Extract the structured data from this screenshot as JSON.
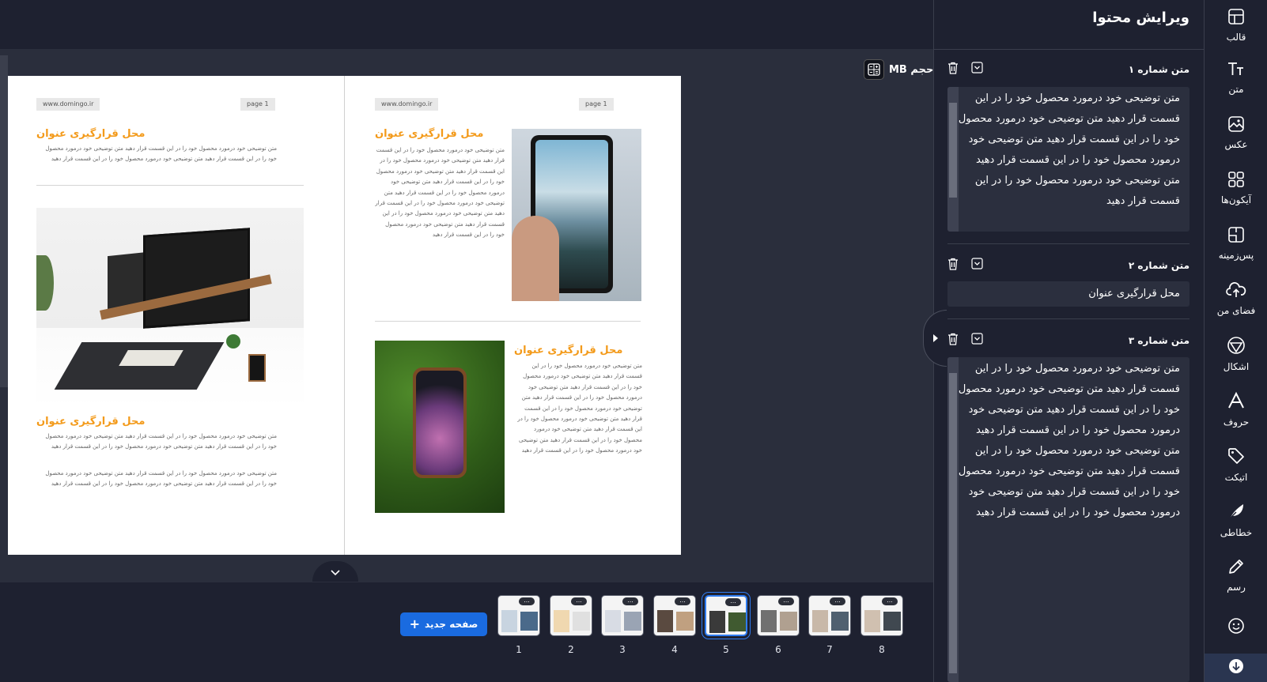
{
  "canvas": {
    "size_label": "حجم MB",
    "pages": [
      {
        "site_url": "www.domingo.ir",
        "page_label": "page 1",
        "heading1": "محل قرارگیری عنوان",
        "text1": "متن توضیحی خود درمورد محصول خود را در این قسمت قرار دهید متن توضیحی خود درمورد محصول خود را در این قسمت قرار دهید متن توضیحی خود درمورد محصول خود را در این قسمت قرار دهید",
        "heading2": "محل قرارگیری عنوان",
        "text2": "متن توضیحی خود درمورد محصول خود را در این قسمت قرار دهید متن توضیحی خود درمورد محصول خود را در این قسمت قرار دهید متن توضیحی خود درمورد محصول خود را در این قسمت قرار دهید",
        "text3": "متن توضیحی خود درمورد محصول خود را در این قسمت قرار دهید متن توضیحی خود درمورد محصول خود را در این قسمت قرار دهید متن توضیحی خود درمورد محصول خود را در این قسمت قرار دهید"
      },
      {
        "site_url": "www.domingo.ir",
        "page_label": "page 1",
        "heading1": "محل قرارگیری عنوان",
        "text1": "متن توضیحی خود درمورد محصول خود را در این قسمت قرار دهید متن توضیحی خود درمورد محصول خود را در این قسمت قرار دهید متن توضیحی خود درمورد محصول خود را در این قسمت قرار دهید متن توضیحی خود درمورد محصول خود را در این قسمت قرار دهید متن توضیحی خود درمورد محصول خود را در این قسمت قرار دهید متن توضیحی خود درمورد محصول خود را در این قسمت قرار دهید متن توضیحی خود درمورد محصول خود را در این قسمت قرار دهید",
        "heading2": "محل قرارگیری عنوان",
        "text2": "متن توضیحی خود درمورد محصول خود را در این قسمت قرار دهید متن توضیحی خود درمورد محصول خود را در این قسمت قرار دهید متن توضیحی خود درمورد محصول خود را در این قسمت قرار دهید متن توضیحی خود درمورد محصول خود را در این قسمت قرار دهید متن توضیحی خود درمورد محصول خود را در این قسمت قرار دهید متن توضیحی خود درمورد محصول خود را در این قسمت قرار دهید متن توضیحی خود درمورد محصول خود را در این قسمت قرار دهید"
      }
    ]
  },
  "bottom": {
    "new_page_label": "صفحه جدید",
    "thumbs": [
      "1",
      "2",
      "3",
      "4",
      "5",
      "6",
      "7",
      "8"
    ],
    "thumb_menu": "...",
    "active_page": "5"
  },
  "panel": {
    "title": "ویرایش محتوا",
    "fields": [
      {
        "name": "متن شماره ۱",
        "value": "متن توضیحی خود درمورد محصول خود را در این قسمت قرار دهید  متن توضیحی خود درمورد محصول خود را در این قسمت قرار دهید  متن توضیحی خود درمورد محصول خود را در این قسمت قرار دهید متن توضیحی خود درمورد محصول خود را در این قسمت قرار دهید"
      },
      {
        "name": "متن شماره ۲",
        "value": "محل قرارگیری عنوان"
      },
      {
        "name": "متن شماره ۳",
        "value": "متن توضیحی خود درمورد محصول خود را در این قسمت قرار دهید  متن توضیحی خود درمورد محصول خود را در این قسمت قرار دهید  متن توضیحی خود درمورد محصول خود را در این قسمت قرار دهید متن توضیحی خود درمورد محصول خود را در این قسمت قرار دهید  متن توضیحی خود درمورد محصول خود را در این قسمت قرار دهید  متن توضیحی خود درمورد محصول خود را در این قسمت قرار دهید"
      }
    ]
  },
  "rail": {
    "items": [
      {
        "label": "قالب",
        "icon": "template-icon"
      },
      {
        "label": "متن",
        "icon": "text-icon"
      },
      {
        "label": "عکس",
        "icon": "image-icon"
      },
      {
        "label": "آیکون‌ها",
        "icon": "icons-grid-icon"
      },
      {
        "label": "پس‌زمینه",
        "icon": "background-icon"
      },
      {
        "label": "فضای من",
        "icon": "cloud-upload-icon"
      },
      {
        "label": "اشکال",
        "icon": "shapes-icon"
      },
      {
        "label": "حروف",
        "icon": "letters-icon"
      },
      {
        "label": "اتیکت",
        "icon": "tag-icon"
      },
      {
        "label": "خطاطی",
        "icon": "feather-icon"
      },
      {
        "label": "رسم",
        "icon": "pencil-icon"
      },
      {
        "label": "",
        "icon": "emoji-icon"
      }
    ]
  },
  "colors": {
    "accent": "#1a6be0",
    "title_orange": "#f39a1a",
    "background": "#1e2130"
  }
}
